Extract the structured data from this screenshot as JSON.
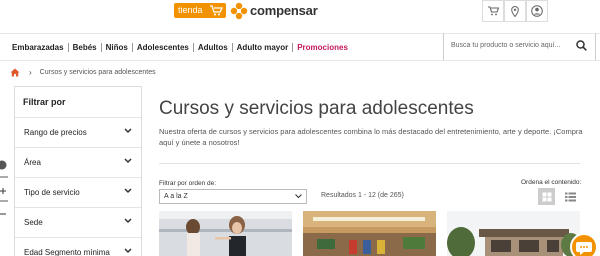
{
  "header": {
    "tienda_label": "tienda",
    "brand_name": "compensar",
    "icons": [
      "cart-icon",
      "location-icon",
      "user-icon"
    ]
  },
  "nav": {
    "items": [
      "Embarazadas",
      "Bebés",
      "Niños",
      "Adolescentes",
      "Adultos",
      "Adulto mayor",
      "Promociones"
    ]
  },
  "search": {
    "placeholder": "Busca tu producto o servicio aquí..."
  },
  "breadcrumb": {
    "home_icon": "home-icon",
    "current": "Cursos y servicios para adolescentes"
  },
  "sidebar": {
    "title": "Filtrar por",
    "filters": [
      "Rango de precios",
      "Área",
      "Tipo de servicio",
      "Sede",
      "Edad Segmento mínima"
    ]
  },
  "main": {
    "title": "Cursos y servicios para adolescentes",
    "description": "Nuestra oferta de cursos y servicios para adolescentes combina lo más destacado del entretenimiento, arte y deporte. ¡Compra aquí y únete a nosotros!",
    "sort_label": "Filtrar por orden de:",
    "sort_value": "A a la Z",
    "results": "Resultados 1 - 12 (de 265)",
    "view_label": "Ordena el contenido:"
  },
  "colors": {
    "brand": "#f39200",
    "promo": "#c2185b",
    "home": "#e05a2b"
  }
}
